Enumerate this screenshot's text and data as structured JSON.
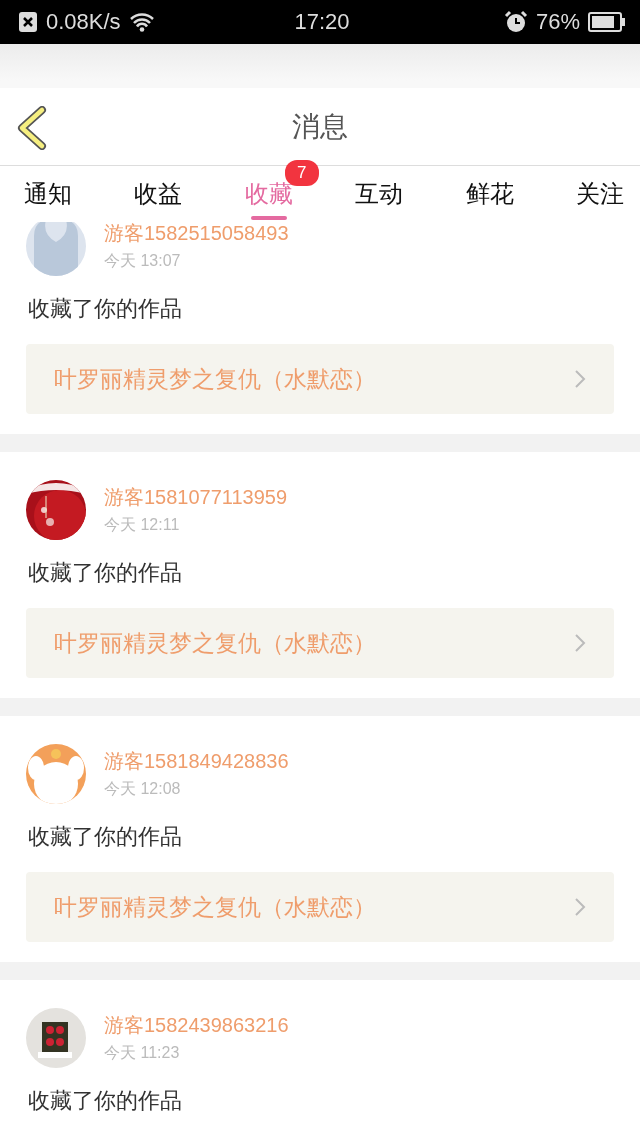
{
  "status_bar": {
    "speed": "0.08K/s",
    "time": "17:20",
    "battery": "76%"
  },
  "header": {
    "title": "消息"
  },
  "tabs": [
    {
      "label": "通知",
      "selected": false
    },
    {
      "label": "收益",
      "selected": false
    },
    {
      "label": "收藏",
      "selected": true,
      "badge": "7"
    },
    {
      "label": "互动",
      "selected": false
    },
    {
      "label": "鲜花",
      "selected": false
    },
    {
      "label": "关注",
      "selected": false
    }
  ],
  "messages": [
    {
      "avatar": {
        "kind": "default"
      },
      "user": "游客1582515058493",
      "time": "今天 13:07",
      "text": "收藏了你的作品",
      "work": "叶罗丽精灵梦之复仇（水默恋）"
    },
    {
      "user": "游客1581077113959",
      "time": "今天 12:11",
      "text": "收藏了你的作品",
      "work": "叶罗丽精灵梦之复仇（水默恋）"
    },
    {
      "user": "游客1581849428836",
      "time": "今天 12:08",
      "text": "收藏了你的作品",
      "work": "叶罗丽精灵梦之复仇（水默恋）"
    },
    {
      "user": "游客1582439863216",
      "time": "今天 11:23",
      "text": "收藏了你的作品"
    }
  ]
}
